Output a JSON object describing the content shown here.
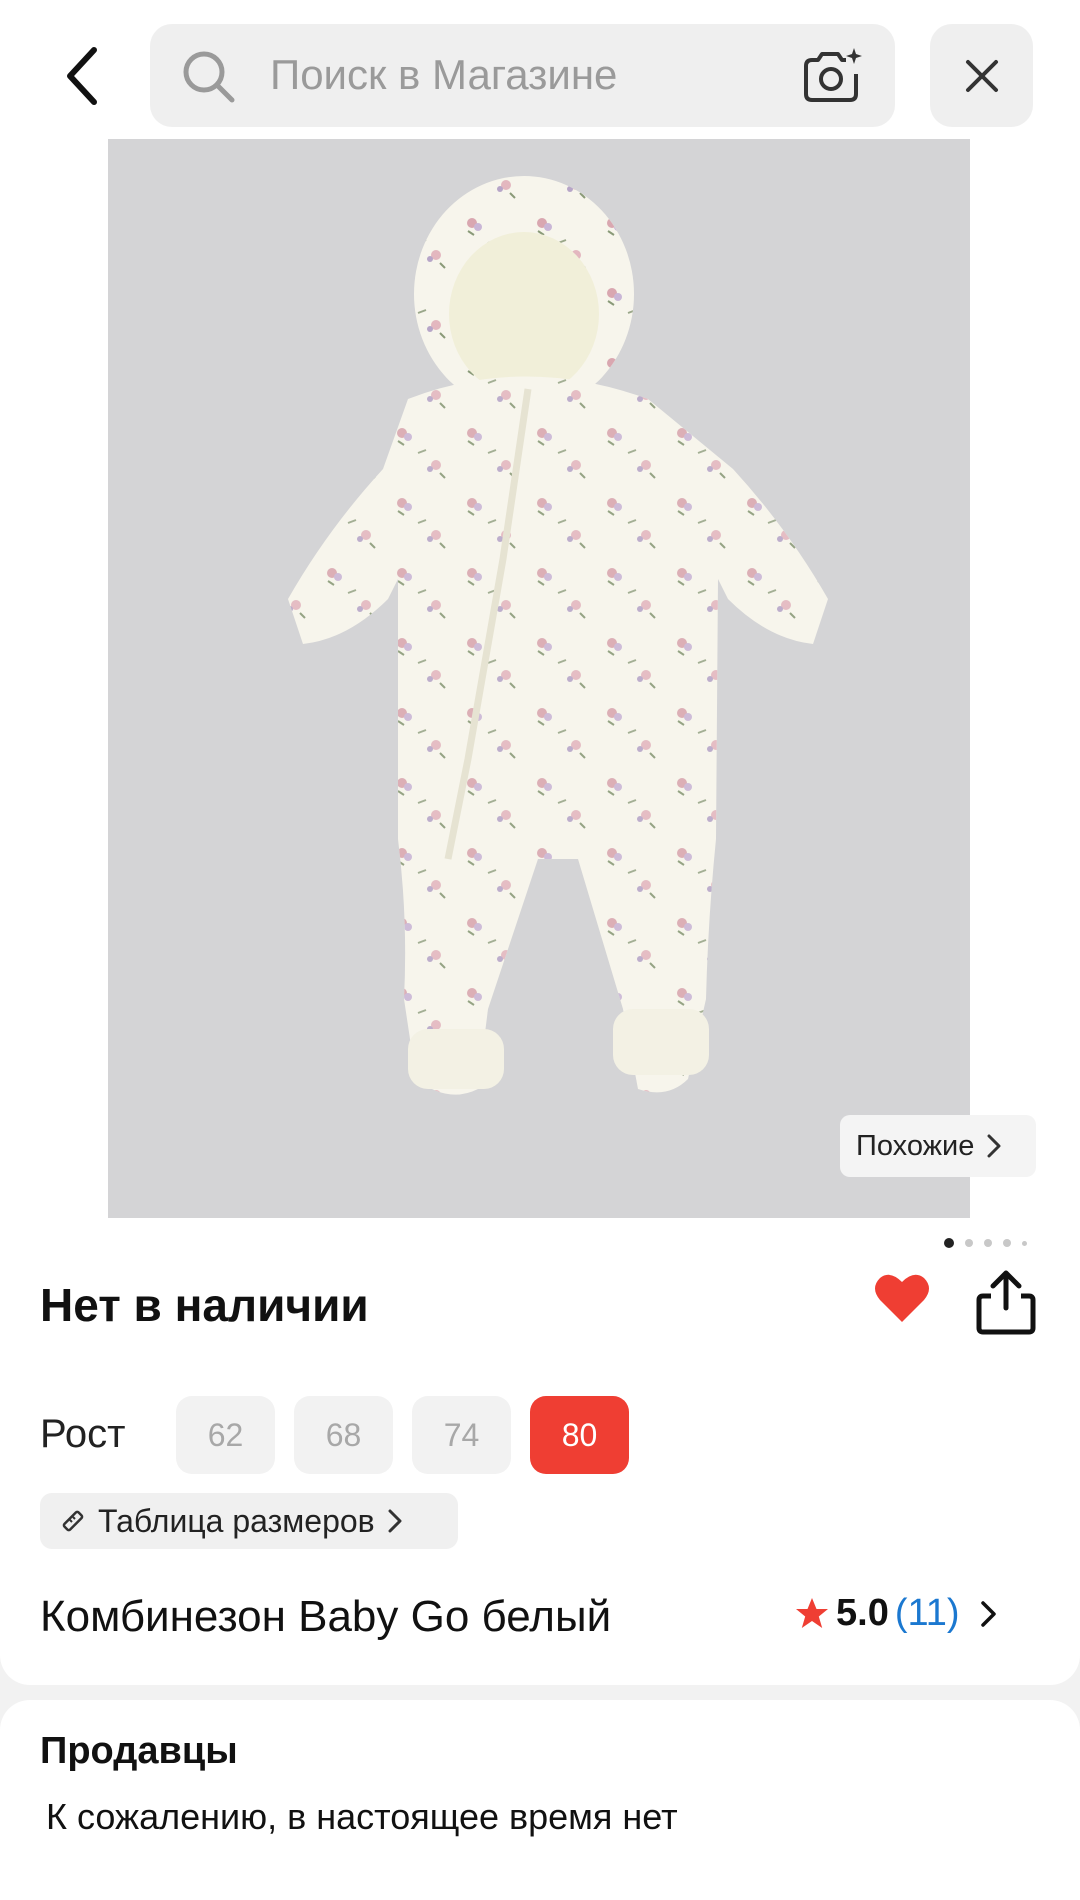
{
  "header": {
    "search_placeholder": "Поиск в Магазине"
  },
  "product": {
    "similar_label": "Похожие",
    "gallery": {
      "count": 5,
      "active_index": 0
    },
    "availability": "Нет в наличии",
    "favorited": true,
    "size_label": "Рост",
    "sizes": [
      "62",
      "68",
      "74",
      "80"
    ],
    "selected_size": "80",
    "size_table_label": "Таблица размеров",
    "title": "Комбинезон Baby Go белый",
    "rating": "5.0",
    "reviews_count": "(11)"
  },
  "sellers": {
    "title": "Продавцы",
    "message": "К сожалению, в настоящее время нет"
  },
  "colors": {
    "accent": "#ef3e33",
    "link": "#1b78d0",
    "chip_bg": "#f2f2f2",
    "image_bg": "#d4d4d6"
  }
}
